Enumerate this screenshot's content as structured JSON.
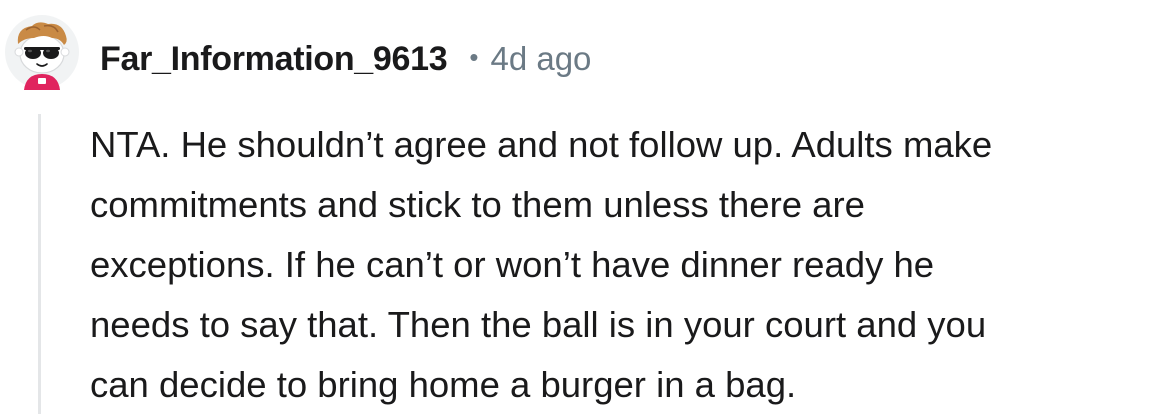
{
  "comment": {
    "username": "Far_Information_9613",
    "separator": "•",
    "timestamp": "4d ago",
    "body_lines": [
      "NTA. He shouldn’t agree and not follow up. Adults make",
      "commitments and stick to them unless there are",
      "exceptions. If he can’t or won’t have dinner ready he",
      "needs to say that. Then the ball is in your court and you",
      "can decide to bring home a burger in a bag."
    ]
  },
  "avatar": {
    "icon": "snoo-avatar-with-sunglasses-icon",
    "colors": {
      "hair": "#c98a45",
      "face": "#ffffff",
      "sunglasses": "#1a1a1b",
      "shirt": "#e0245e"
    }
  },
  "colors": {
    "text": "#1a1a1b",
    "meta": "#6b7a85",
    "thread_line": "#e4e6e8"
  }
}
